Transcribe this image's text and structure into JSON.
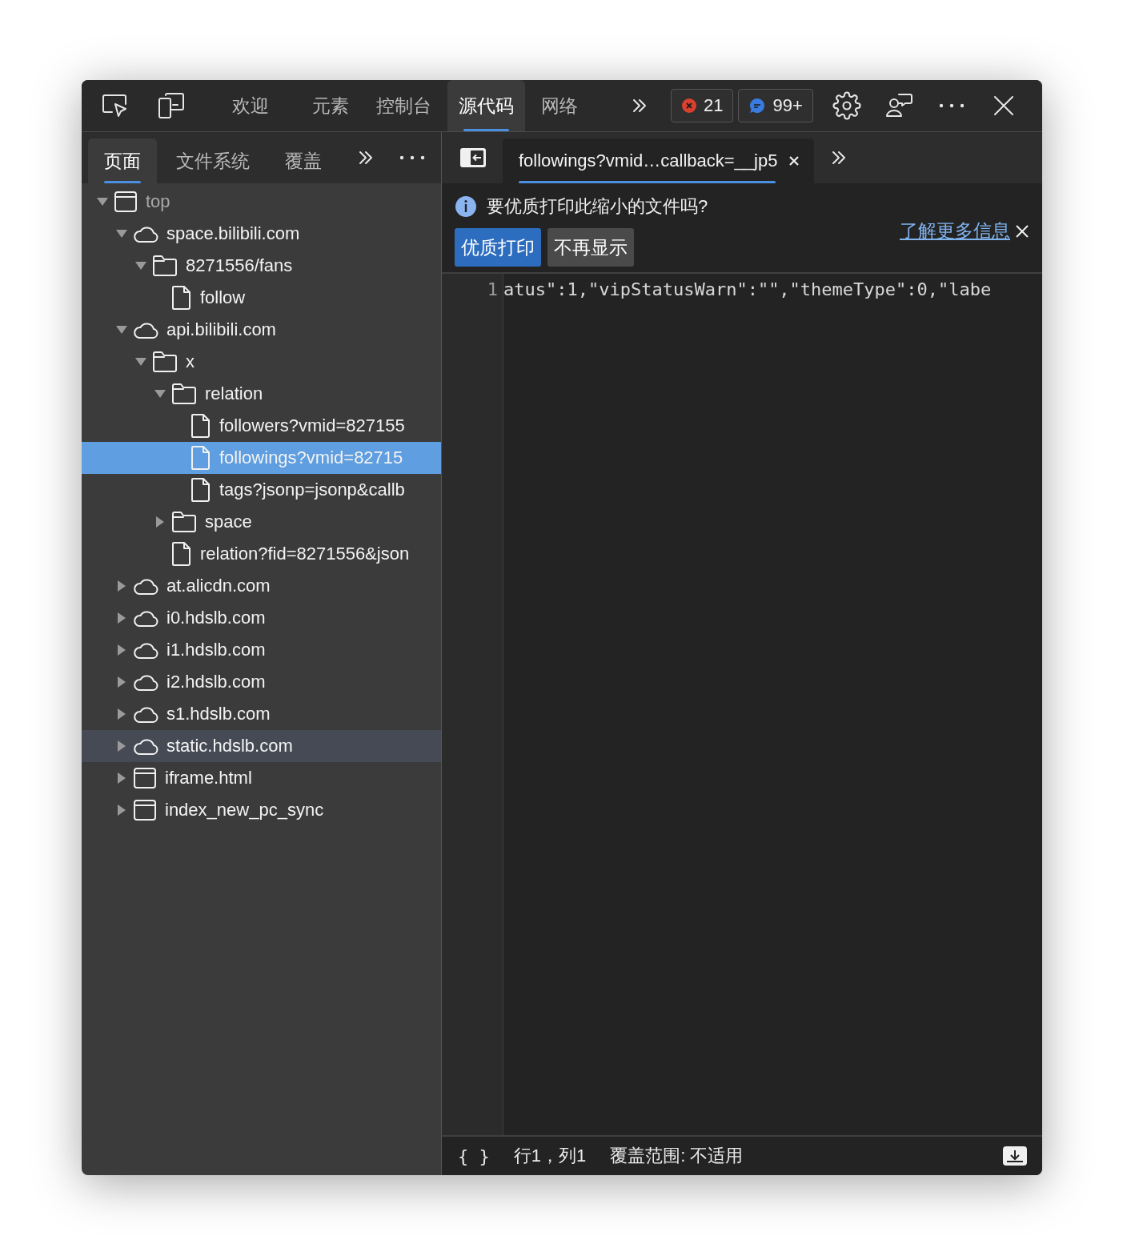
{
  "toolbar": {
    "tabs": [
      {
        "label": "欢迎",
        "selected": false
      },
      {
        "label": "元素",
        "selected": false
      },
      {
        "label": "控制台",
        "selected": false
      },
      {
        "label": "源代码",
        "selected": true
      },
      {
        "label": "网络",
        "selected": false
      }
    ],
    "errors": "21",
    "messages": "99+"
  },
  "sidebar": {
    "tabs": [
      {
        "label": "页面",
        "selected": true
      },
      {
        "label": "文件系统",
        "selected": false
      },
      {
        "label": "覆盖",
        "selected": false
      }
    ],
    "tree": [
      {
        "label": "top",
        "kind": "frame",
        "expanded": true,
        "selected": false,
        "hovered": false,
        "children": [
          {
            "label": "space.bilibili.com",
            "kind": "cloud",
            "expanded": true,
            "selected": false,
            "hovered": false,
            "children": [
              {
                "label": "8271556/fans",
                "kind": "folder",
                "expanded": true,
                "selected": false,
                "hovered": false,
                "children": [
                  {
                    "label": "follow",
                    "kind": "file",
                    "selected": false,
                    "hovered": false
                  }
                ]
              }
            ]
          },
          {
            "label": "api.bilibili.com",
            "kind": "cloud",
            "expanded": true,
            "selected": false,
            "hovered": false,
            "children": [
              {
                "label": "x",
                "kind": "folder",
                "expanded": true,
                "selected": false,
                "hovered": false,
                "children": [
                  {
                    "label": "relation",
                    "kind": "folder",
                    "expanded": true,
                    "selected": false,
                    "hovered": false,
                    "children": [
                      {
                        "label": "followers?vmid=827155",
                        "kind": "file",
                        "selected": false,
                        "hovered": false
                      },
                      {
                        "label": "followings?vmid=82715",
                        "kind": "file",
                        "selected": true,
                        "hovered": false
                      },
                      {
                        "label": "tags?jsonp=jsonp&callb",
                        "kind": "file",
                        "selected": false,
                        "hovered": false
                      }
                    ]
                  },
                  {
                    "label": "space",
                    "kind": "folder",
                    "expanded": false,
                    "selected": false,
                    "hovered": false
                  },
                  {
                    "label": "relation?fid=8271556&json",
                    "kind": "file",
                    "selected": false,
                    "hovered": false
                  }
                ]
              }
            ]
          },
          {
            "label": "at.alicdn.com",
            "kind": "cloud",
            "expanded": false,
            "selected": false,
            "hovered": false
          },
          {
            "label": "i0.hdslb.com",
            "kind": "cloud",
            "expanded": false,
            "selected": false,
            "hovered": false
          },
          {
            "label": "i1.hdslb.com",
            "kind": "cloud",
            "expanded": false,
            "selected": false,
            "hovered": false
          },
          {
            "label": "i2.hdslb.com",
            "kind": "cloud",
            "expanded": false,
            "selected": false,
            "hovered": false
          },
          {
            "label": "s1.hdslb.com",
            "kind": "cloud",
            "expanded": false,
            "selected": false,
            "hovered": false
          },
          {
            "label": "static.hdslb.com",
            "kind": "cloud",
            "expanded": false,
            "selected": false,
            "hovered": true
          },
          {
            "label": "iframe.html",
            "kind": "frame",
            "expanded": false,
            "selected": false,
            "hovered": false
          },
          {
            "label": "index_new_pc_sync",
            "kind": "frame",
            "expanded": false,
            "selected": false,
            "hovered": false
          }
        ]
      }
    ]
  },
  "editor": {
    "tab": {
      "label": "followings?vmid…callback=__jp5",
      "selected": true
    },
    "banner": {
      "message": "要优质打印此缩小的文件吗?",
      "primary_button": "优质打印",
      "secondary_button": "不再显示",
      "link": "了解更多信息"
    },
    "lines": [
      {
        "number": "1",
        "text": "atus\":1,\"vipStatusWarn\":\"\",\"themeType\":0,\"labe"
      }
    ]
  },
  "status_bar": {
    "pretty_print": "{ }",
    "position": "行1，列1",
    "coverage": "覆盖范围: 不适用"
  }
}
